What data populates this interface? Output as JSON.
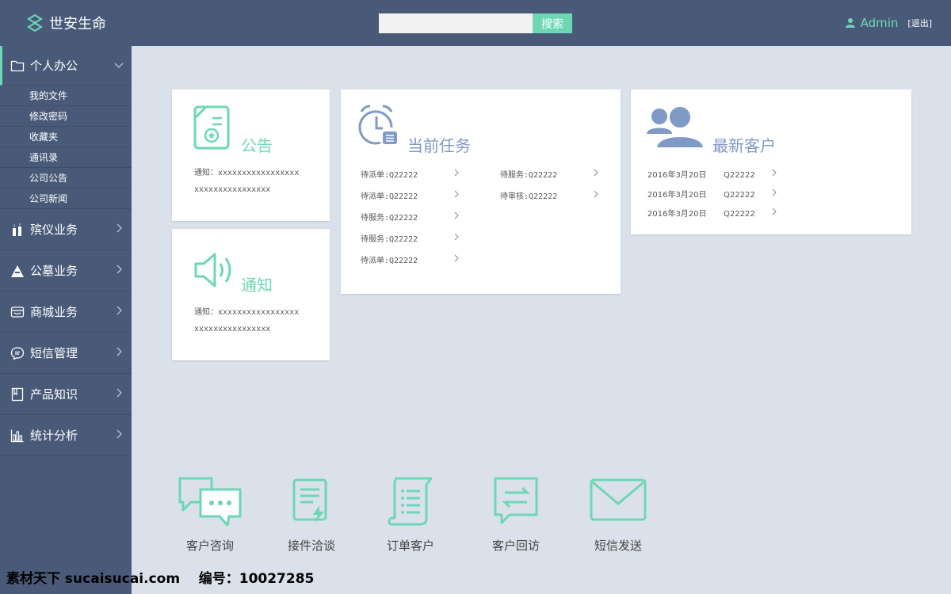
{
  "header": {
    "brand": "世安生命",
    "search_placeholder": "",
    "search_button": "搜索",
    "user_name": "Admin",
    "logout": "[退出]"
  },
  "sidebar": {
    "items": [
      {
        "label": "个人办公",
        "icon": "folder-icon",
        "expanded": true,
        "children": [
          "我的文件",
          "修改密码",
          "收藏夹",
          "通讯录",
          "公司公告",
          "公司新闻"
        ]
      },
      {
        "label": "殡仪业务",
        "icon": "candle-icon"
      },
      {
        "label": "公墓业务",
        "icon": "tomb-icon"
      },
      {
        "label": "商城业务",
        "icon": "store-icon"
      },
      {
        "label": "短信管理",
        "icon": "message-icon"
      },
      {
        "label": "产品知识",
        "icon": "book-icon"
      },
      {
        "label": "统计分析",
        "icon": "bar-chart-icon"
      }
    ]
  },
  "cards": {
    "announcement": {
      "title": "公告",
      "line1": "通知：xxxxxxxxxxxxxxxxx",
      "line2": "xxxxxxxxxxxxxxxx"
    },
    "notice": {
      "title": "通知",
      "line1": "通知：xxxxxxxxxxxxxxxxx",
      "line2": "xxxxxxxxxxxxxxxx"
    },
    "tasks": {
      "title": "当前任务",
      "left": [
        "待派单:Q22222",
        "待派单:Q22222",
        "待服务:Q22222",
        "待服务:Q22222",
        "待派单:Q22222"
      ],
      "right": [
        "待服务:Q22222",
        "待审核:Q22222"
      ]
    },
    "customers": {
      "title": "最新客户",
      "rows": [
        {
          "date": "2016年3月20日",
          "code": "Q22222"
        },
        {
          "date": "2016年3月20日",
          "code": "Q22222"
        },
        {
          "date": "2016年3月20日",
          "code": "Q22222"
        }
      ]
    }
  },
  "shortcuts": [
    "客户咨询",
    "接件洽谈",
    "订单客户",
    "客户回访",
    "短信发送"
  ],
  "watermark": {
    "site": "素材天下 sucaisucai.com",
    "id": "编号：10027285"
  },
  "colors": {
    "accent": "#6dd7b5",
    "nav": "#495a78",
    "blue_icon": "#7e9ac5",
    "background": "#dbe1ea"
  }
}
